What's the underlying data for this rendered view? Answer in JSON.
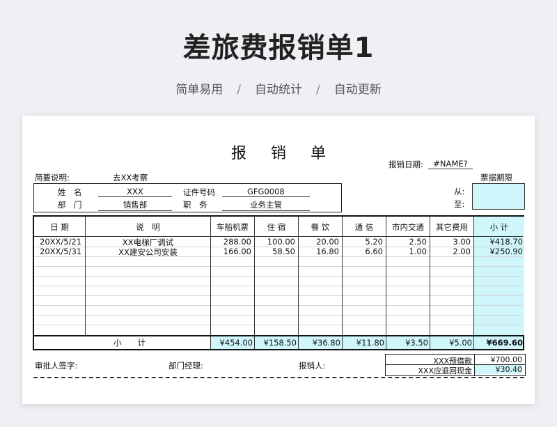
{
  "hero": {
    "title": "差旅费报销单1",
    "tags": [
      "简单易用",
      "自动统计",
      "自动更新"
    ],
    "separator": "/"
  },
  "doc": {
    "title_chars": [
      "报",
      "销",
      "单"
    ],
    "date_label": "报销日期:",
    "date_value": "#NAME?",
    "summary_label": "简要说明:",
    "summary_value": "去XX考察",
    "receipt_period_label": "票据期限",
    "name_label": "姓　名",
    "name_value": "XXX",
    "cert_label": "证件号码",
    "cert_value": "GFG0008",
    "dept_label": "部　门",
    "dept_value": "销售部",
    "position_label": "职　务",
    "position_value": "业务主管",
    "from_label": "从:",
    "to_label": "至:"
  },
  "table": {
    "headers": [
      "日 期",
      "说　明",
      "车船机票",
      "住 宿",
      "餐 饮",
      "通 信",
      "市内交通",
      "其它费用",
      "小 计"
    ],
    "rows": [
      {
        "date": "20XX/5/21",
        "desc": "XX电梯厂调试",
        "ticket": "288.00",
        "lodging": "100.00",
        "meals": "20.00",
        "comm": "5.20",
        "local": "2.50",
        "other": "3.00",
        "subtotal": "¥418.70"
      },
      {
        "date": "20XX/5/31",
        "desc": "XX建安公司安装",
        "ticket": "166.00",
        "lodging": "58.50",
        "meals": "16.80",
        "comm": "6.60",
        "local": "1.00",
        "other": "2.00",
        "subtotal": "¥250.90"
      }
    ],
    "total_label": "小　　计",
    "totals": {
      "ticket": "¥454.00",
      "lodging": "¥158.50",
      "meals": "¥36.80",
      "comm": "¥11.80",
      "local": "¥3.50",
      "other": "¥5.00",
      "grand": "¥669.60"
    }
  },
  "footer": {
    "approver_label": "审批人签字:",
    "manager_label": "部门经理:",
    "claimant_label": "报销人:",
    "advance_label": "XXX预借款",
    "advance_value": "¥700.00",
    "refund_label": "XXX应退回现金",
    "refund_value": "¥30.40"
  }
}
